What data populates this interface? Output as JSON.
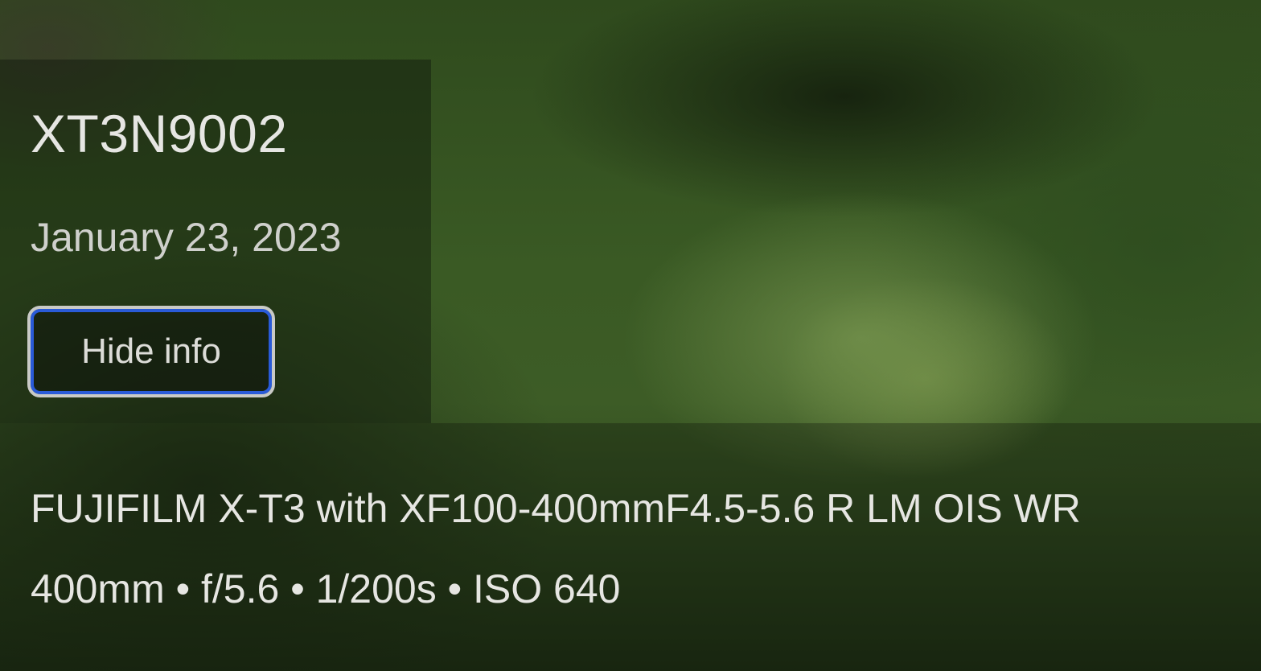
{
  "photo": {
    "title": "XT3N9002",
    "date": "January 23, 2023"
  },
  "controls": {
    "hide_info_label": "Hide info"
  },
  "metadata": {
    "camera_lens": "FUJIFILM X-T3 with XF100-400mmF4.5-5.6 R LM OIS WR",
    "exposure": "400mm • f/5.6 • 1/200s • ISO 640"
  },
  "colors": {
    "focus_ring": "#2a5bd8",
    "text_primary": "#e6e6e3",
    "text_secondary": "#cfd0cc"
  }
}
